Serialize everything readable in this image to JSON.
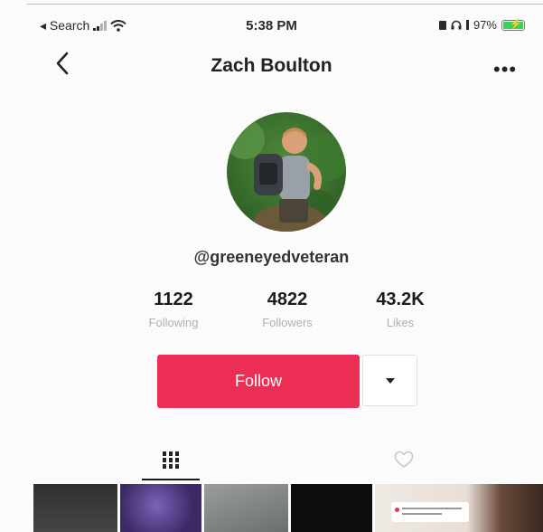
{
  "status_bar": {
    "back_app": "◂ Search",
    "time": "5:38 PM",
    "battery": "97%"
  },
  "nav": {
    "title": "Zach Boulton",
    "back_icon": "chevron-left-icon",
    "more_icon": "more-icon",
    "more_glyph": "•••"
  },
  "profile": {
    "username": "@greeneyedveteran",
    "stats": [
      {
        "value": "1122",
        "label": "Following"
      },
      {
        "value": "4822",
        "label": "Followers"
      },
      {
        "value": "43.2K",
        "label": "Likes"
      }
    ]
  },
  "actions": {
    "follow_label": "Follow"
  },
  "tabs": {
    "videos_icon": "grid-icon",
    "liked_icon": "heart-icon"
  },
  "colors": {
    "follow": "#ec2e54",
    "battery": "#3ecf5b"
  }
}
